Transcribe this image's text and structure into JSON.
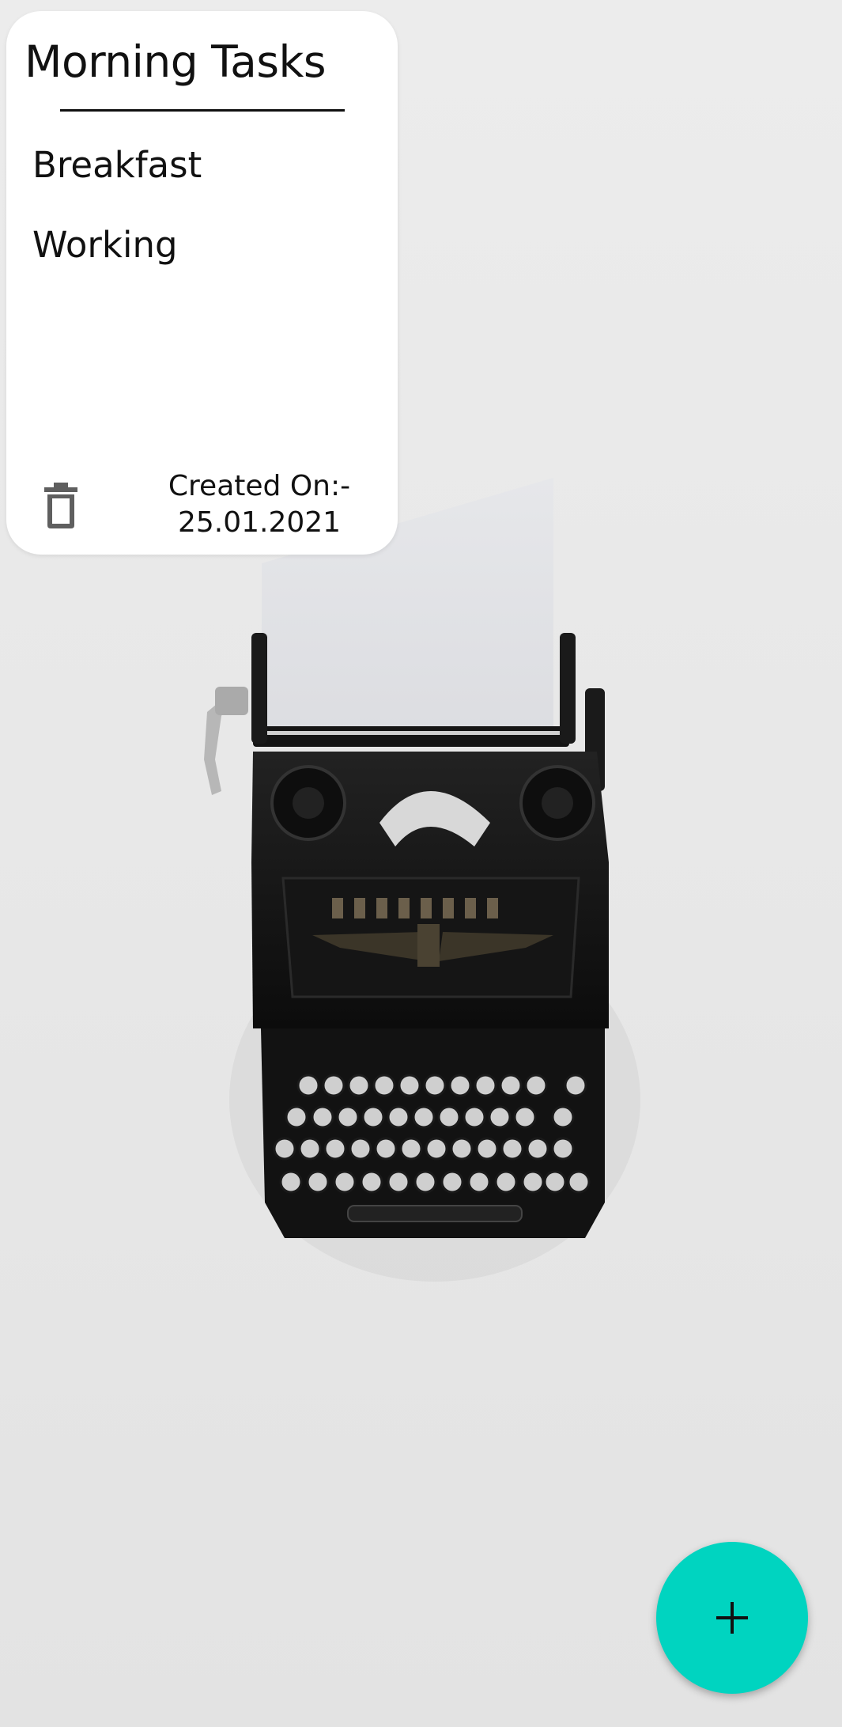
{
  "note": {
    "title": "Morning Tasks",
    "tasks": [
      "Breakfast",
      "Working"
    ],
    "created_label": "Created On:-",
    "created_date": "25.01.2021",
    "delete_icon": "trash-icon"
  },
  "fab": {
    "icon": "plus-icon"
  },
  "background": {
    "image": "typewriter-photo"
  },
  "colors": {
    "accent": "#00d4c0",
    "card": "#ffffff",
    "background": "#e9e9e9"
  }
}
